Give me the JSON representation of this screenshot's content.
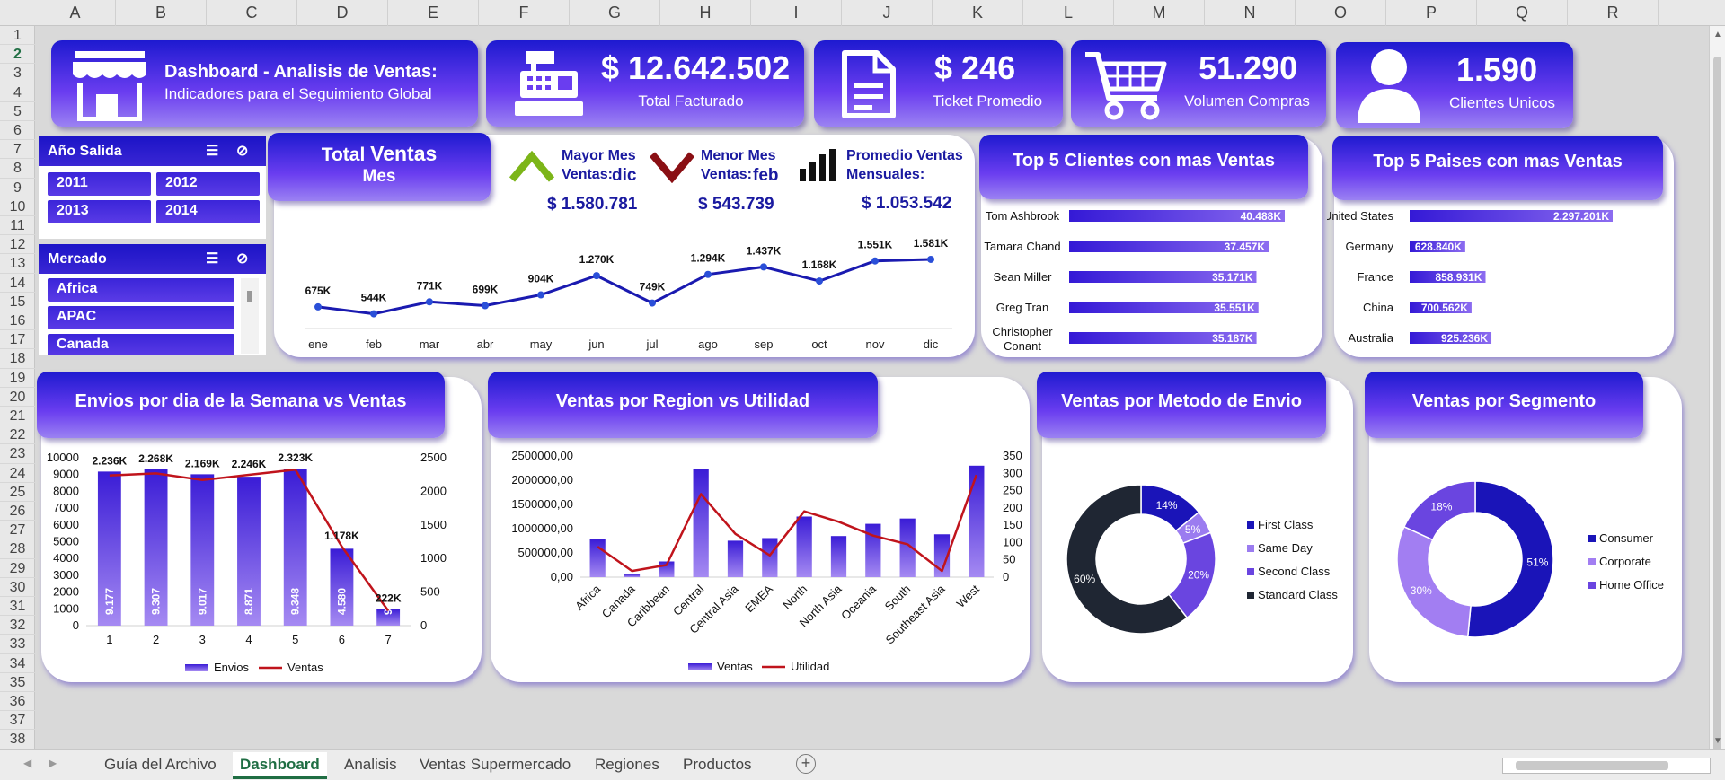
{
  "columns": [
    "A",
    "B",
    "C",
    "D",
    "E",
    "F",
    "G",
    "H",
    "I",
    "J",
    "K",
    "L",
    "M",
    "N",
    "O",
    "P",
    "Q",
    "R"
  ],
  "rows": [
    "1",
    "2",
    "3",
    "4",
    "5",
    "6",
    "7",
    "8",
    "9",
    "10",
    "11",
    "12",
    "13",
    "14",
    "15",
    "16",
    "17",
    "18",
    "19",
    "20",
    "21",
    "22",
    "23",
    "24",
    "25",
    "26",
    "27",
    "28",
    "29",
    "30",
    "31",
    "32",
    "33",
    "34",
    "35",
    "36",
    "37",
    "38"
  ],
  "header": {
    "title": "Dashboard - Analisis de Ventas:",
    "subtitle": "Indicadores para el Seguimiento Global"
  },
  "kpis": {
    "total_facturado": {
      "value": "$ 12.642.502",
      "label": "Total Facturado"
    },
    "ticket_promedio": {
      "value": "$ 246",
      "label": "Ticket Promedio"
    },
    "volumen_compras": {
      "value": "51.290",
      "label": "Volumen Compras"
    },
    "clientes_unicos": {
      "value": "1.590",
      "label": "Clientes Unicos"
    }
  },
  "slicer_anio": {
    "title": "Año Salida",
    "items": [
      "2011",
      "2012",
      "2013",
      "2014"
    ]
  },
  "slicer_mercado": {
    "title": "Mercado",
    "items": [
      "Africa",
      "APAC",
      "Canada"
    ]
  },
  "ventas_mes": {
    "title_line1": "Total",
    "title_bold": "Ventas",
    "title_line2": "Mes",
    "mayor_label": "Mayor Mes Ventas:",
    "mayor_mes": "dic",
    "mayor_value": "$ 1.580.781",
    "menor_label": "Menor Mes Ventas:",
    "menor_mes": "feb",
    "menor_value": "$ 543.739",
    "promedio_label": "Promedio Ventas Mensuales:",
    "promedio_value": "$ 1.053.542"
  },
  "top_clientes": {
    "title": "Top 5 Clientes con mas Ventas"
  },
  "top_paises": {
    "title": "Top 5 Paises con mas Ventas"
  },
  "envios_semana": {
    "title": "Envios por dia de la Semana vs Ventas"
  },
  "region_utilidad": {
    "title": "Ventas por Region vs Utilidad"
  },
  "metodo_envio": {
    "title": "Ventas por Metodo de Envio"
  },
  "segmento": {
    "title": "Ventas por Segmento"
  },
  "sheet_tabs": [
    "Guía del Archivo",
    "Dashboard",
    "Analisis",
    "Ventas Supermercado",
    "Regiones",
    "Productos"
  ],
  "active_tab": "Dashboard",
  "colors": {
    "accent": "#1a1ab4",
    "bar": "#5b3be8",
    "line": "#c0141c",
    "dark": "#1e2a3a"
  },
  "chart_data": [
    {
      "type": "line",
      "categories": [
        "ene",
        "feb",
        "mar",
        "abr",
        "may",
        "jun",
        "jul",
        "ago",
        "sep",
        "oct",
        "nov",
        "dic"
      ],
      "values": [
        675,
        544,
        771,
        699,
        904,
        1270,
        749,
        1294,
        1437,
        1168,
        1551,
        1581
      ],
      "labels": [
        "675K",
        "544K",
        "771K",
        "699K",
        "904K",
        "1.270K",
        "749K",
        "1.294K",
        "1.437K",
        "1.168K",
        "1.551K",
        "1.581K"
      ]
    },
    {
      "type": "bar",
      "orientation": "horizontal",
      "categories": [
        "Tom Ashbrook",
        "Tamara Chand",
        "Sean Miller",
        "Greg Tran",
        "Christopher Conant"
      ],
      "values": [
        40488,
        37457,
        35171,
        35551,
        35187
      ],
      "labels": [
        "40.488K",
        "37.457K",
        "35.171K",
        "35.551K",
        "35.187K"
      ]
    },
    {
      "type": "bar",
      "orientation": "horizontal",
      "categories": [
        "United States",
        "Germany",
        "France",
        "China",
        "Australia"
      ],
      "values": [
        2297201,
        628840,
        858931,
        700562,
        925236
      ],
      "labels": [
        "2.297.201K",
        "628.840K",
        "858.931K",
        "700.562K",
        "925.236K"
      ]
    },
    {
      "type": "bar",
      "categories": [
        "1",
        "2",
        "3",
        "4",
        "5",
        "6",
        "7"
      ],
      "series": [
        {
          "name": "Envios",
          "values": [
            9177,
            9307,
            9017,
            8871,
            9348,
            4580,
            990
          ],
          "labels": [
            "9.177",
            "9.307",
            "9.017",
            "8.871",
            "9.348",
            "4.580",
            "990"
          ]
        },
        {
          "name": "Ventas",
          "values": [
            2236,
            2268,
            2169,
            2246,
            2323,
            1178,
            222
          ],
          "labels": [
            "2.236K",
            "2.268K",
            "2.169K",
            "2.246K",
            "2.323K",
            "1.178K",
            "222K"
          ]
        }
      ],
      "y_left_ticks": [
        "10000",
        "9000",
        "8000",
        "7000",
        "6000",
        "5000",
        "4000",
        "3000",
        "2000",
        "1000",
        "0"
      ],
      "y_right_ticks": [
        "2500",
        "2000",
        "1500",
        "1000",
        "500",
        "0"
      ],
      "ylim_left": [
        0,
        10000
      ],
      "ylim_right": [
        0,
        2500
      ]
    },
    {
      "type": "bar",
      "categories": [
        "Africa",
        "Canada",
        "Caribbean",
        "Central",
        "Central Asia",
        "EMEA",
        "North",
        "North Asia",
        "Oceania",
        "South",
        "Southeast Asia",
        "West"
      ],
      "series": [
        {
          "name": "Ventas",
          "values": [
            783000,
            66000,
            324000,
            2230000,
            752000,
            806000,
            1250000,
            848000,
            1100000,
            1210000,
            884000,
            2300000
          ]
        },
        {
          "name": "Utilidad",
          "values": [
            88,
            18,
            35,
            240,
            125,
            63,
            190,
            160,
            120,
            95,
            18,
            295
          ]
        }
      ],
      "y_left_ticks": [
        "2500000,00",
        "2000000,00",
        "1500000,00",
        "1000000,00",
        "500000,00",
        "0,00"
      ],
      "y_right_ticks": [
        "350",
        "300",
        "250",
        "200",
        "150",
        "100",
        "50",
        "0"
      ],
      "ylim_left": [
        0,
        2500000
      ],
      "ylim_right": [
        0,
        350
      ]
    },
    {
      "type": "pie",
      "donut": true,
      "categories": [
        "First Class",
        "Same Day",
        "Second Class",
        "Standard Class"
      ],
      "values": [
        14,
        5,
        20,
        60
      ],
      "labels": [
        "14%",
        "5%",
        "20%",
        "60%"
      ],
      "colors": [
        "#1a14b8",
        "#9b7cf0",
        "#6a45e0",
        "#1f2633"
      ]
    },
    {
      "type": "pie",
      "donut": true,
      "categories": [
        "Consumer",
        "Corporate",
        "Home Office"
      ],
      "values": [
        51,
        30,
        18
      ],
      "labels": [
        "51%",
        "30%",
        "18%"
      ],
      "colors": [
        "#1a14b8",
        "#a27ef2",
        "#6a45e0"
      ]
    }
  ]
}
